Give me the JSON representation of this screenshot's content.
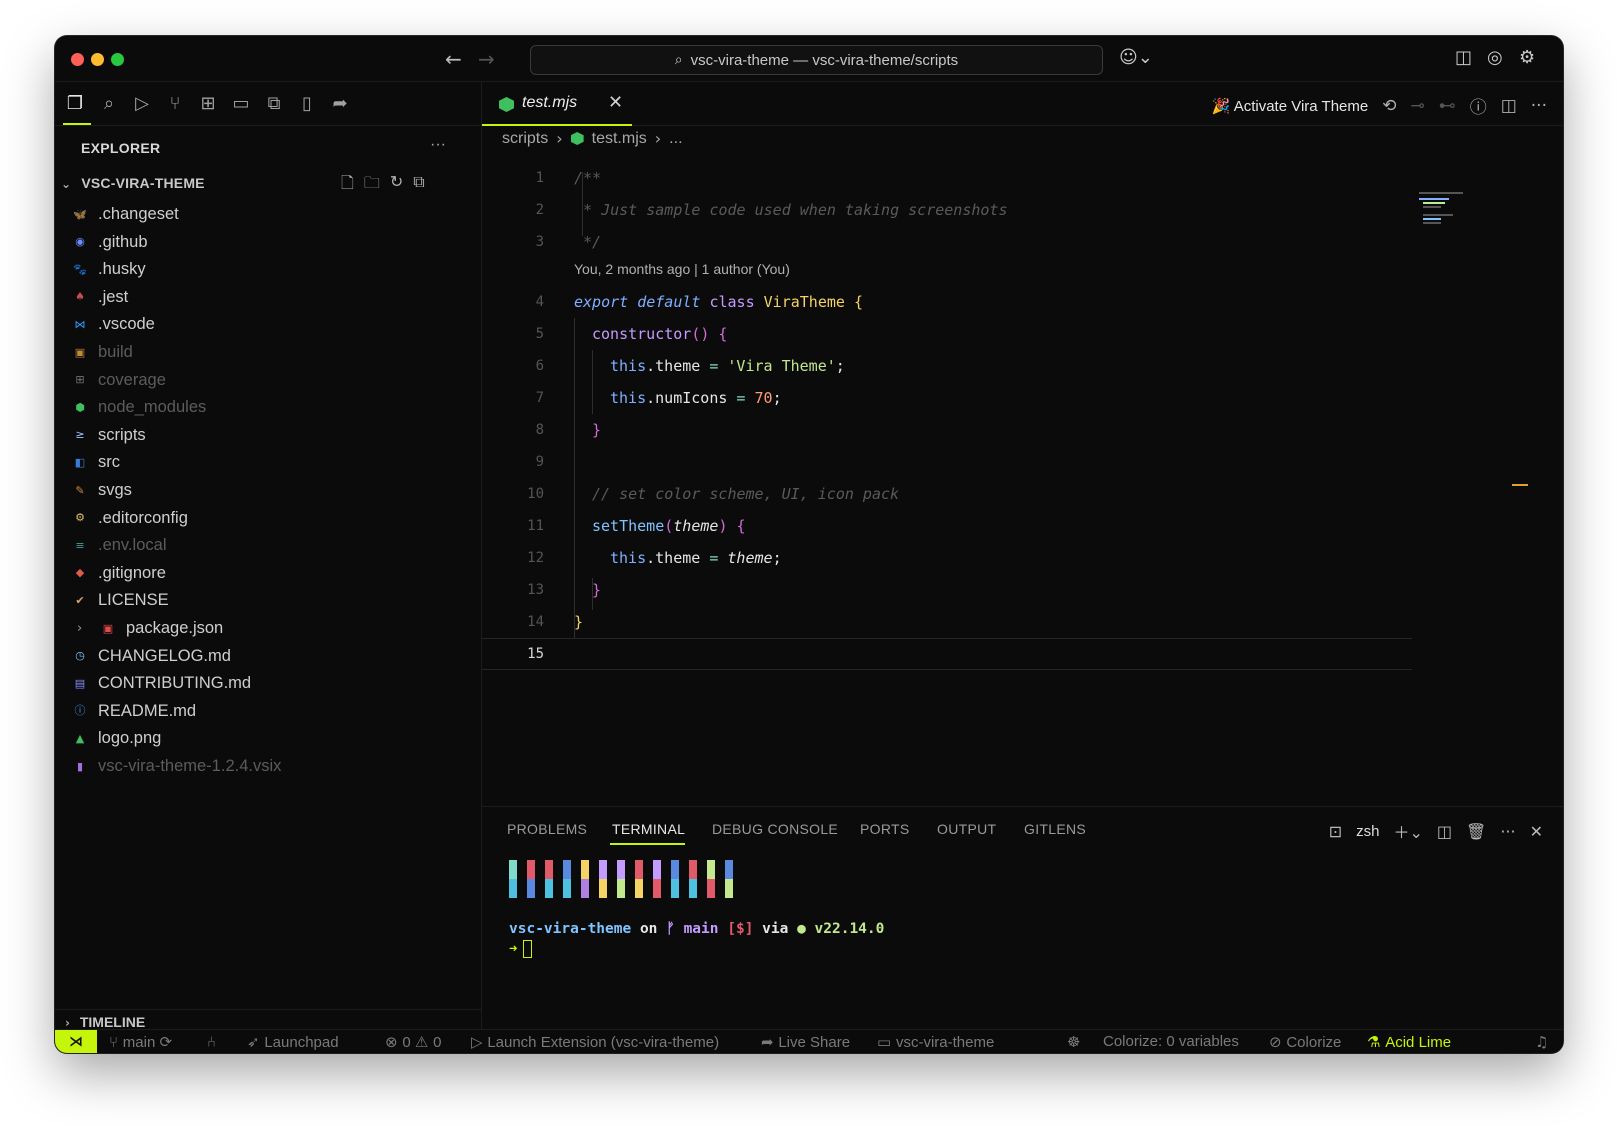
{
  "window": {
    "command_center": "vsc-vira-theme — vsc-vira-theme/scripts"
  },
  "sidebar": {
    "explorer_title": "EXPLORER",
    "folder_name": "VSC-VIRA-THEME",
    "timeline_label": "TIMELINE",
    "items": [
      {
        "label": ".changeset",
        "icon": "folder-changeset-icon",
        "color": "#1e90ff",
        "dim": false
      },
      {
        "label": ".github",
        "icon": "folder-github-icon",
        "color": "#6a8cff",
        "dim": false
      },
      {
        "label": ".husky",
        "icon": "folder-husky-icon",
        "color": "#808080",
        "dim": false
      },
      {
        "label": ".jest",
        "icon": "folder-jest-icon",
        "color": "#c25050",
        "dim": false
      },
      {
        "label": ".vscode",
        "icon": "folder-vscode-icon",
        "color": "#2ea0ff",
        "dim": false
      },
      {
        "label": "build",
        "icon": "folder-build-icon",
        "color": "#c08a3a",
        "dim": true
      },
      {
        "label": "coverage",
        "icon": "folder-coverage-icon",
        "color": "#707070",
        "dim": true
      },
      {
        "label": "node_modules",
        "icon": "folder-node-icon",
        "color": "#3fbf5f",
        "dim": true
      },
      {
        "label": "scripts",
        "icon": "folder-scripts-icon",
        "color": "#a0c4ff",
        "dim": false
      },
      {
        "label": "src",
        "icon": "folder-src-icon",
        "color": "#3a7bd5",
        "dim": false
      },
      {
        "label": "svgs",
        "icon": "folder-svg-icon",
        "color": "#d08a3a",
        "dim": false
      },
      {
        "label": ".editorconfig",
        "icon": "editorconfig-icon",
        "color": "#e0c060",
        "dim": false
      },
      {
        "label": ".env.local",
        "icon": "env-icon",
        "color": "#40a0a0",
        "dim": true
      },
      {
        "label": ".gitignore",
        "icon": "git-icon",
        "color": "#e05a4a",
        "dim": false
      },
      {
        "label": "LICENSE",
        "icon": "license-icon",
        "color": "#e0a060",
        "dim": false
      },
      {
        "label": "package.json",
        "icon": "npm-icon",
        "color": "#e04a4a",
        "dim": false
      },
      {
        "label": "CHANGELOG.md",
        "icon": "changelog-icon",
        "color": "#7fc4ff",
        "dim": false
      },
      {
        "label": "CONTRIBUTING.md",
        "icon": "contributing-icon",
        "color": "#8a8aff",
        "dim": false
      },
      {
        "label": "README.md",
        "icon": "readme-icon",
        "color": "#3fa0ff",
        "dim": false
      },
      {
        "label": "logo.png",
        "icon": "image-icon",
        "color": "#3fbf5f",
        "dim": false
      },
      {
        "label": "vsc-vira-theme-1.2.4.vsix",
        "icon": "vsix-icon",
        "color": "#a070e0",
        "dim": true
      }
    ]
  },
  "editor": {
    "tab_label": "test.mjs",
    "activate_label": "Activate Vira Theme",
    "breadcrumb": {
      "folder": "scripts",
      "file": "test.mjs",
      "more": "..."
    },
    "blame": "You, 2 months ago | 1 author (You)",
    "line_numbers": [
      "1",
      "2",
      "3",
      "4",
      "5",
      "6",
      "7",
      "8",
      "9",
      "10",
      "11",
      "12",
      "13",
      "14",
      "15"
    ],
    "code": {
      "l1": "/**",
      "l2": " * Just sample code used when taking screenshots",
      "l3": " */",
      "l4_kw1": "export",
      "l4_kw2": "default",
      "l4_kw3": "class",
      "l4_cls": "ViraTheme",
      "l4_brace": "{",
      "l5_fn": "constructor",
      "l5_rest": "() {",
      "l6_this": "this",
      "l6_prop": ".theme",
      "l6_op": " = ",
      "l6_str": "'Vira Theme'",
      "l6_end": ";",
      "l7_this": "this",
      "l7_prop": ".numIcons",
      "l7_op": " = ",
      "l7_num": "70",
      "l7_end": ";",
      "l8": "}",
      "l10": "// set color scheme, UI, icon pack",
      "l11_fn": "setTheme",
      "l11_p1": "(",
      "l11_param": "theme",
      "l11_p2": ") {",
      "l12_this": "this",
      "l12_prop": ".theme",
      "l12_op": " = ",
      "l12_val": "theme",
      "l12_end": ";",
      "l13": "}",
      "l14": "}"
    }
  },
  "panel": {
    "tabs": [
      "PROBLEMS",
      "TERMINAL",
      "DEBUG CONSOLE",
      "PORTS",
      "OUTPUT",
      "GITLENS"
    ],
    "active_tab": "TERMINAL",
    "shell": "zsh",
    "prompt": {
      "dir": "vsc-vira-theme",
      "on": " on ",
      "branch_icon": "ᚠ",
      "branch": " main",
      "status": " [$]",
      "via": " via ",
      "node": "● v22.14.0"
    },
    "arrow": "➜",
    "swatch_colors": [
      [
        "#7fdbca",
        "#4fc0e0"
      ],
      [
        "#e05a6a",
        "#5a8ae0"
      ],
      [
        "#e05a6a",
        "#4fc0e0"
      ],
      [
        "#5a8ae0",
        "#4fc0e0"
      ],
      [
        "#f6d365",
        "#b080e0"
      ],
      [
        "#c49bff",
        "#f6d365"
      ],
      [
        "#c49bff",
        "#c3e88d"
      ],
      [
        "#e05a6a",
        "#f6d365"
      ],
      [
        "#c49bff",
        "#e05a6a"
      ],
      [
        "#5a8ae0",
        "#4fc0e0"
      ],
      [
        "#e05a6a",
        "#4fc0e0"
      ],
      [
        "#c3e88d",
        "#e05a6a"
      ],
      [
        "#5a8ae0",
        "#c3e88d"
      ]
    ]
  },
  "statusbar": {
    "branch": "main",
    "launchpad": "Launchpad",
    "errors": "0",
    "warnings": "0",
    "launch": "Launch Extension (vsc-vira-theme)",
    "live_share": "Live Share",
    "workspace": "vsc-vira-theme",
    "colorize_vars": "Colorize: 0 variables",
    "colorize": "Colorize",
    "theme": "Acid Lime"
  },
  "colors": {
    "accent": "#c5f50a",
    "background": "#0b0b0b"
  }
}
